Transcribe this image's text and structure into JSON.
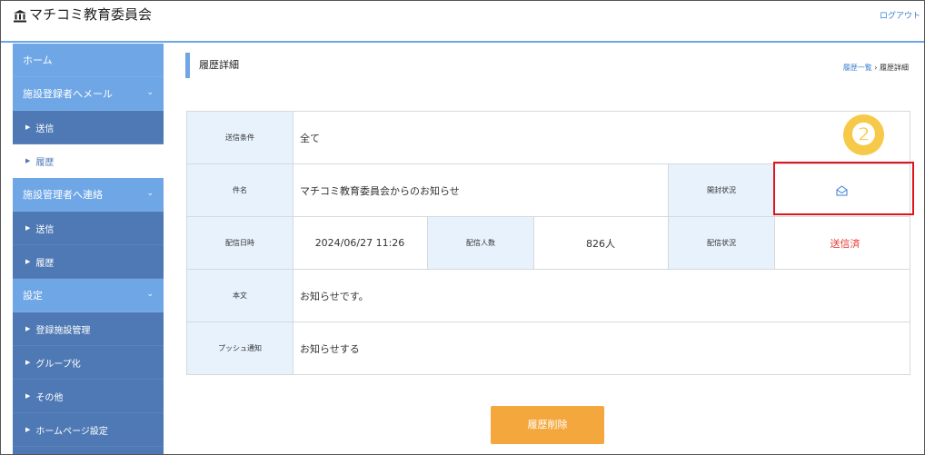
{
  "header": {
    "title": "マチコミ教育委員会",
    "logout": "ログアウト"
  },
  "sidebar": {
    "home": "ホーム",
    "section1": {
      "title": "施設登録者へメール",
      "send": "送信",
      "history": "履歴"
    },
    "section2": {
      "title": "施設管理者へ連絡",
      "send": "送信",
      "history": "履歴"
    },
    "section3": {
      "title": "設定",
      "items": [
        "登録施設管理",
        "グループ化",
        "その他",
        "ホームページ設定"
      ]
    }
  },
  "page": {
    "title": "履歴詳細",
    "breadcrumb": {
      "parent": "履歴一覧",
      "separator": "›",
      "current": "履歴詳細"
    }
  },
  "detail": {
    "send_condition_label": "送信条件",
    "send_condition": "全て",
    "subject_label": "件名",
    "subject": "マチコミ教育委員会からのお知らせ",
    "open_status_label": "開封状況",
    "send_date_label": "配信日時",
    "send_date": "2024/06/27 11:26",
    "recipients_label": "配信人数",
    "recipients": "826人",
    "delivery_status_label": "配信状況",
    "delivery_status": "送信済",
    "body_label": "本文",
    "body": "お知らせです。",
    "push_label": "プッシュ通知",
    "push": "お知らせする"
  },
  "annotation": {
    "badge": "❷"
  },
  "actions": {
    "delete": "履歴削除"
  },
  "colors": {
    "accent": "#6ea6e6",
    "sidebar": "#4f79b4",
    "label_bg": "#e7f2fc",
    "delete": "#f4a73d",
    "sent": "#e53935",
    "highlight": "#e0141e"
  },
  "icons": {
    "logo": "building-icon",
    "open_status": "envelope-open-icon"
  }
}
